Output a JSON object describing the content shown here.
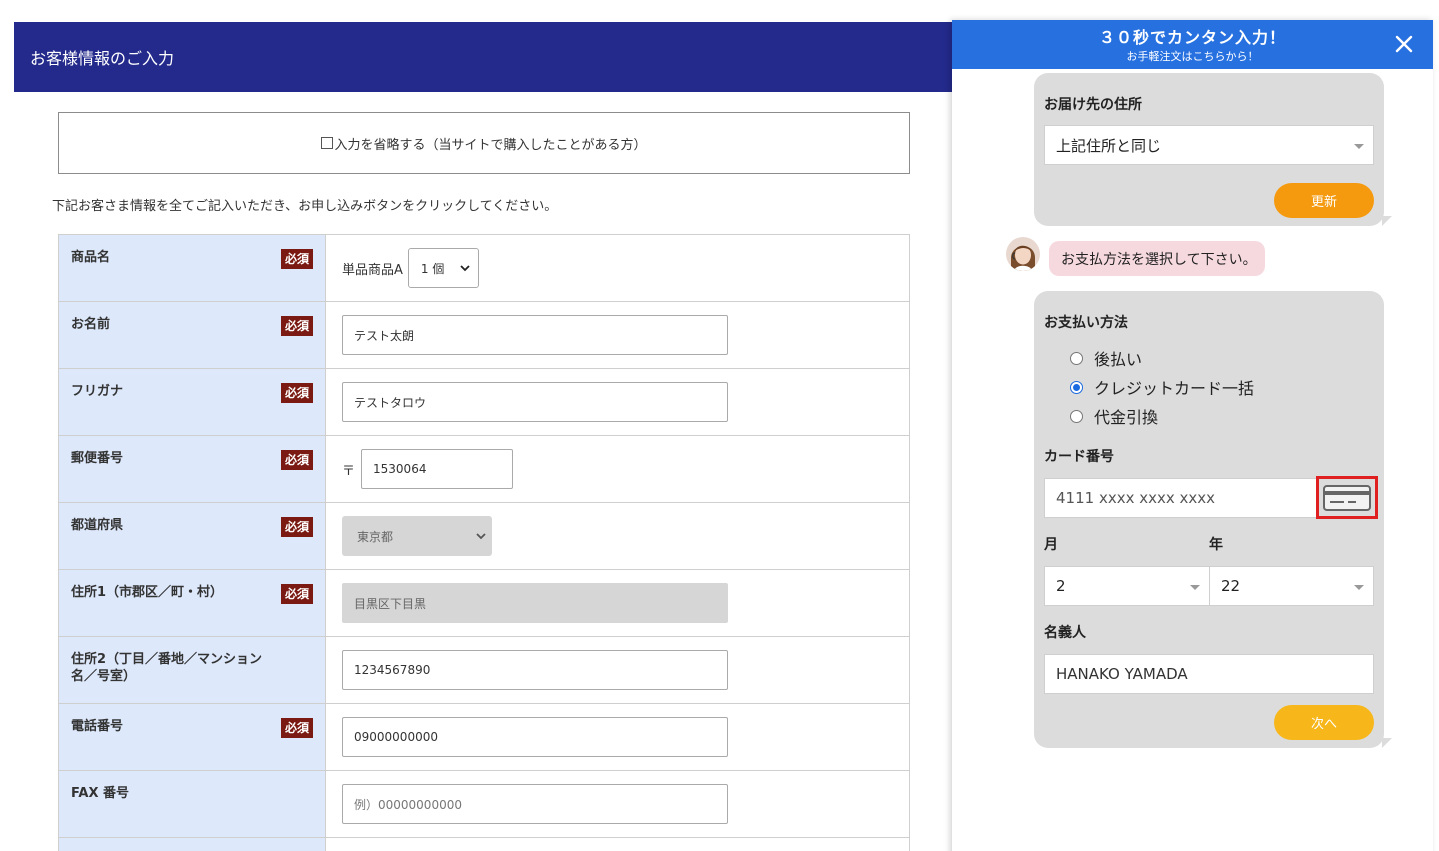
{
  "left": {
    "header_title": "お客様情報のご入力",
    "skip_label": "入力を省略する（当サイトで購入したことがある方）",
    "intro_text": "下記お客さま情報を全てご記入いただき、お申し込みボタンをクリックしてください。",
    "required_badge": "必須",
    "rows": [
      {
        "label": "商品名",
        "required": true,
        "product_name": "単品商品A",
        "quantity": "1 個"
      },
      {
        "label": "お名前",
        "required": true,
        "value": "テスト太朗"
      },
      {
        "label": "フリガナ",
        "required": true,
        "value": "テストタロウ"
      },
      {
        "label": "郵便番号",
        "required": true,
        "zip_mark": "〒",
        "value": "1530064"
      },
      {
        "label": "都道府県",
        "required": true,
        "value": "東京都"
      },
      {
        "label": "住所1（市郡区／町・村）",
        "required": true,
        "value": "目黒区下目黒"
      },
      {
        "label": "住所2（丁目／番地／マンション名／号室）",
        "required": false,
        "value": "1234567890"
      },
      {
        "label": "電話番号",
        "required": true,
        "value": "09000000000"
      },
      {
        "label": "FAX 番号",
        "required": false,
        "placeholder": "例）00000000000"
      }
    ]
  },
  "panel": {
    "title": "３０秒でカンタン入力！",
    "subtitle": "お手軽注文はこちらから！",
    "delivery": {
      "label": "お届け先の住所",
      "selected": "上記住所と同じ",
      "update_button": "更新"
    },
    "operator_message": "お支払方法を選択して下さい。",
    "payment": {
      "label": "お支払い方法",
      "options": [
        "後払い",
        "クレジットカード一括",
        "代金引換"
      ],
      "selected_index": 1,
      "card_number_label": "カード番号",
      "card_number_value": "4111 xxxx xxxx xxxx",
      "month_label": "月",
      "month_value": "2",
      "year_label": "年",
      "year_value": "22",
      "holder_label": "名義人",
      "holder_value": "HANAKO YAMADA",
      "next_button": "次へ"
    },
    "colors": {
      "header_bg": "#2670e0",
      "left_header_bg": "#232a8b",
      "required_badge_bg": "#7a1a12",
      "update_button_bg": "#f59a0e",
      "next_button_bg": "#f7b71a",
      "highlight_border": "#e02020"
    }
  }
}
